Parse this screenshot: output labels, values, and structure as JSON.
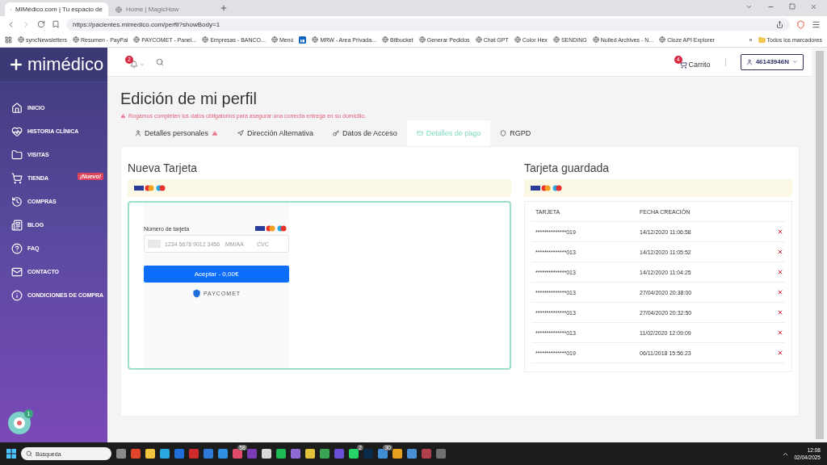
{
  "browser": {
    "tabs": [
      {
        "label": "MiMédico.com | Tu espacio de",
        "selected": true
      },
      {
        "label": "Home | MagicHow",
        "selected": false
      }
    ],
    "url": "https://pacientes.mimedico.com/perfil?showBody=1",
    "bookmarks": [
      {
        "label": "syncNewsletters"
      },
      {
        "label": "Resumen - PayPal"
      },
      {
        "label": "PAYCOMET - Panel..."
      },
      {
        "label": "Empresas - BANCO..."
      },
      {
        "label": "Menú"
      },
      {
        "kind": "icon"
      },
      {
        "label": "MRW - Area Privada..."
      },
      {
        "label": "Bitbucket"
      },
      {
        "label": "Generar Pedidos"
      },
      {
        "label": "Chat GPT"
      },
      {
        "label": "Color Hex"
      },
      {
        "label": "SENDING"
      },
      {
        "label": "Nulled Archives - N..."
      },
      {
        "label": "Cloze API Explorer"
      }
    ],
    "more": "»",
    "all_bookmarks": "Todos los marcadores"
  },
  "sidebar": {
    "logo": "mimédico",
    "items": [
      {
        "label": "INICIO",
        "selected": false
      },
      {
        "label": "HISTORIA CLÍNICA",
        "selected": false
      },
      {
        "label": "VISITAS",
        "selected": false
      },
      {
        "label": "TIENDA",
        "selected": false,
        "badge": "¡Nuevo!"
      },
      {
        "label": "COMPRAS",
        "selected": false
      },
      {
        "label": "BLOG",
        "selected": false
      },
      {
        "label": "FAQ",
        "selected": false
      },
      {
        "label": "CONTACTO",
        "selected": false
      },
      {
        "label": "CONDICIONES DE COMPRA",
        "selected": false
      }
    ],
    "chat_badge": "1"
  },
  "header": {
    "notifications": "2",
    "cart_count": "4",
    "cart_label": "Carrito",
    "user": "46143946N"
  },
  "page": {
    "title": "Edición de mi perfil",
    "warning": "Rogamos completen los datos obligatorios para asegurar una correcta entrega en su domicilio.",
    "tabs": [
      {
        "label": "Detalles personales",
        "warning": true,
        "selected": false
      },
      {
        "label": "Dirección Alternativa",
        "warning": false,
        "selected": false
      },
      {
        "label": "Datos de Acceso",
        "warning": false,
        "selected": false
      },
      {
        "label": "Detalles de pago",
        "warning": false,
        "selected": true
      },
      {
        "label": "RGPD",
        "warning": false,
        "selected": false
      }
    ]
  },
  "new_card": {
    "title": "Nueva Tarjeta",
    "field_label": "Número de tarjeta",
    "number_placeholder": "1234 5678 9012 3456",
    "expiry_placeholder": "MM/AA",
    "cvc_placeholder": "CVC",
    "button": "Aceptar - 0,00€",
    "provider": "PAYCOMET"
  },
  "saved_cards": {
    "title": "Tarjeta guardada",
    "columns": [
      "TARJETA",
      "FECHA CREACIÓN"
    ],
    "rows": [
      {
        "card": "**************019",
        "date": "14/12/2020 11:06:58"
      },
      {
        "card": "**************013",
        "date": "14/12/2020 11:05:52"
      },
      {
        "card": "**************013",
        "date": "14/12/2020 11:04:25"
      },
      {
        "card": "**************013",
        "date": "27/04/2020 20:38:00"
      },
      {
        "card": "**************013",
        "date": "27/04/2020 20:32:50"
      },
      {
        "card": "**************013",
        "date": "11/02/2020 12:09:09"
      },
      {
        "card": "**************019",
        "date": "06/11/2018 15:56:23"
      }
    ]
  },
  "taskbar": {
    "search_placeholder": "Búsqueda",
    "apps": [
      {
        "color": "#8a8a8a"
      },
      {
        "color": "#e0452b"
      },
      {
        "color": "#f2c33d"
      },
      {
        "color": "#2aa6e0"
      },
      {
        "color": "#1e6fd9"
      },
      {
        "color": "#d02c2c"
      },
      {
        "color": "#2d7bd6"
      },
      {
        "color": "#2f8fe0"
      },
      {
        "color": "#e04b6a",
        "badge": "58"
      },
      {
        "color": "#7a3bb5"
      },
      {
        "color": "#d8d8d8"
      },
      {
        "color": "#1db954"
      },
      {
        "color": "#8f6bd8"
      },
      {
        "color": "#e2c23a"
      },
      {
        "color": "#3aa655"
      },
      {
        "color": "#6a4fd6"
      },
      {
        "color": "#25d366",
        "badge": "2"
      },
      {
        "color": "#0c2a4a"
      },
      {
        "color": "#3f8fd6",
        "badge": "30"
      },
      {
        "color": "#e8a020"
      },
      {
        "color": "#4a90d6"
      },
      {
        "color": "#b04050"
      },
      {
        "color": "#707070"
      }
    ],
    "time": "12:08",
    "date": "02/04/2025"
  }
}
